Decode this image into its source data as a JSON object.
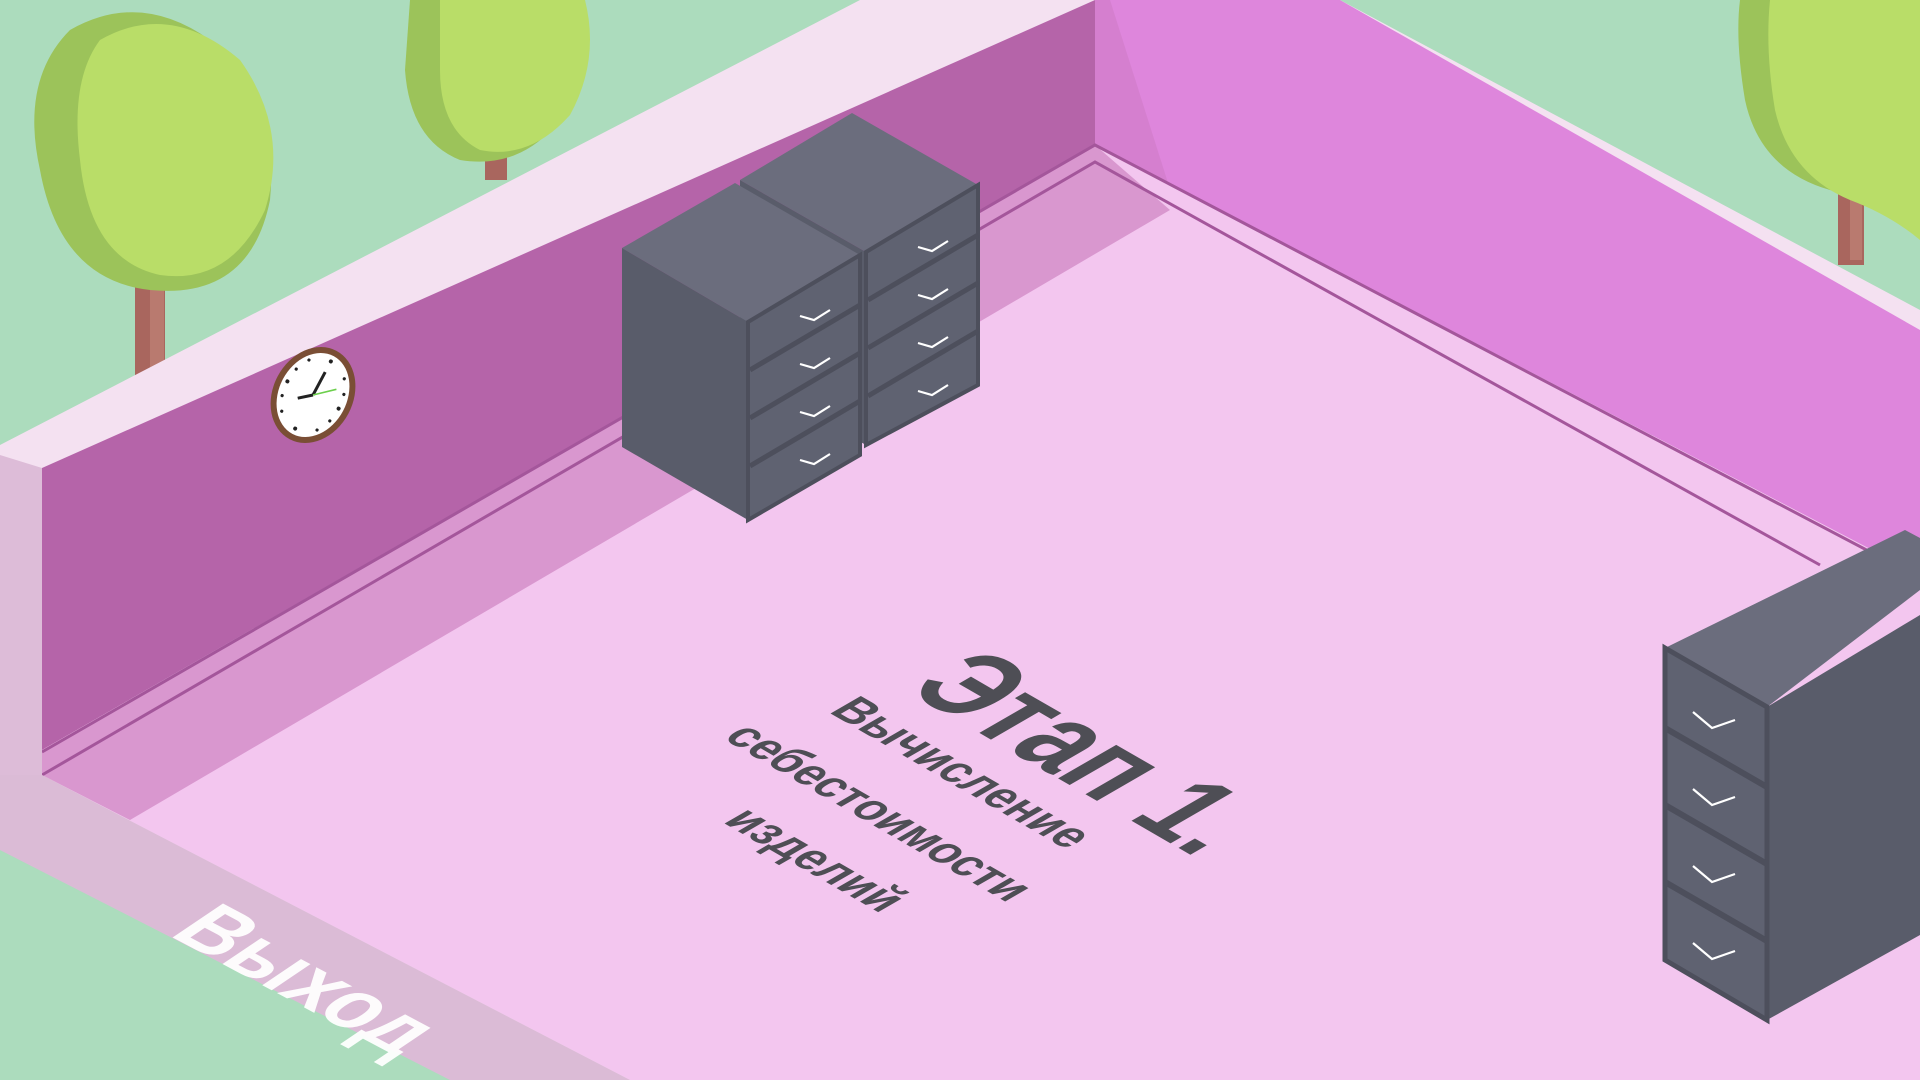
{
  "scene": {
    "stage_title": "Этап 1.",
    "stage_subtitle_lines": [
      "Вычисление",
      "себестоимости",
      "изделий"
    ],
    "exit_label": "Выход"
  },
  "colors": {
    "grass": "#acdcbd",
    "back_wall_left": "#b564a9",
    "back_wall_right": "#de86dc",
    "wall_top": "#f4e1f1",
    "floor": "#f3c6ef",
    "floor_shadow": "#d997cf",
    "front_wall": "#ddbcd8",
    "cabinet_top": "#6b6d7d",
    "cabinet_side": "#595c6a",
    "cabinet_front": "#5f6271",
    "tree_leaf": "#b9dd68",
    "tree_leaf_shade": "#9cc35a",
    "tree_trunk": "#a9665e",
    "clock_rim": "#7a4e35",
    "text_dark": "#4e4e55"
  },
  "icons": [
    "tree-icon",
    "wall-clock-icon",
    "file-cabinet-icon",
    "drawer-handle-icon"
  ]
}
